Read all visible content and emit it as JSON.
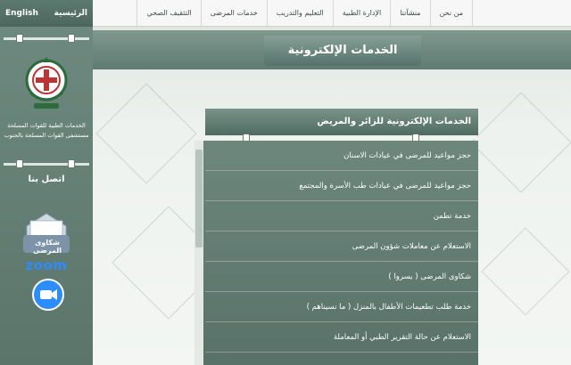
{
  "topnav": {
    "items": [
      "من نحن",
      "منشآتنا",
      "الإدارة الطبية",
      "التعليم والتدريب",
      "خدمات المرضى",
      "التثقيف الصحي"
    ]
  },
  "sidebar": {
    "home_label": "الرئيسية",
    "english_label": "English",
    "org_name_line1": "الخدمات الطبية للقوات المسلحة",
    "org_name_line2": "مستشفى القوات المسلحة بالجنوب",
    "contact_label": "اتصل بنا",
    "complaints_label": "شكاوى المرضى",
    "zoom_label": "zoom"
  },
  "main": {
    "banner_title": "الخدمات الإلكترونية",
    "services": {
      "heading": "الخدمات الإلكترونية للزائر والمريض",
      "items": [
        "حجز مواعيد للمرضى في عيادات الاسنان",
        "حجز مواعيد للمرضى في عيادات طب الأسرة والمجتمع",
        "خدمة تطمن",
        "الاستعلام عن معاملات شؤون المرضى",
        "شكاوى المرضى ( يسروا )",
        "خدمة طلب تطعيمات الأطفال بالمنزل ( ما نسيناهم )",
        "الاستعلام عن حالة التقرير الطبي أو المعاملة"
      ]
    }
  },
  "colors": {
    "sidebar_green": "#5b756b",
    "panel_green": "#587269",
    "zoom_blue": "#2d8cff"
  }
}
